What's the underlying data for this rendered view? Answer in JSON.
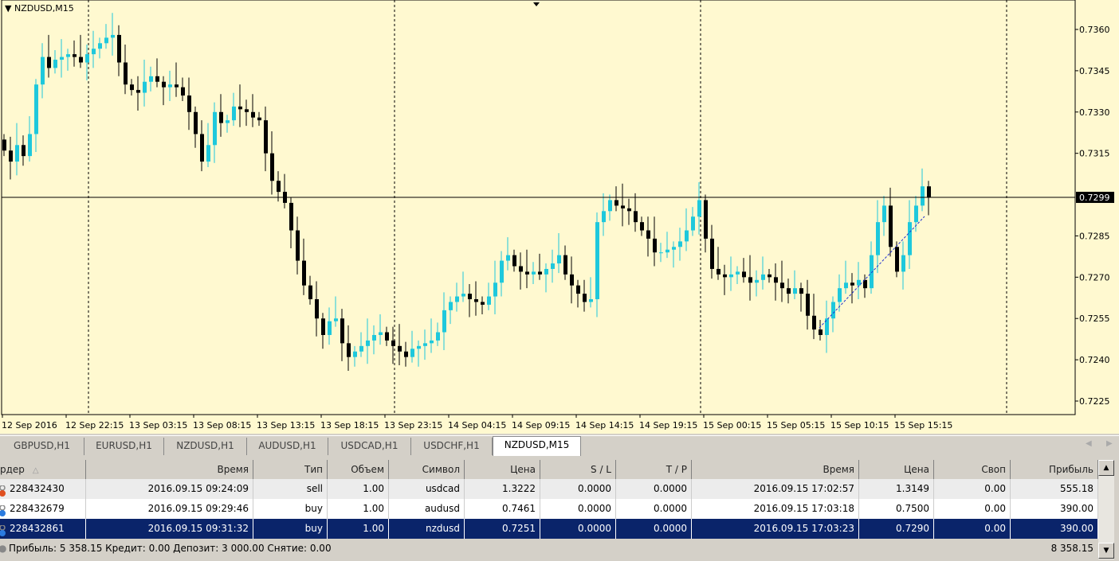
{
  "chart": {
    "symbol_label": "NZDUSD,M15",
    "background": "#fff9d0",
    "bull_color": "#1ec8dc",
    "bear_color": "#000000",
    "current_price": "0.7299",
    "price_ticks": [
      "0.7360",
      "0.7345",
      "0.7330",
      "0.7315",
      "0.7285",
      "0.7270",
      "0.7255",
      "0.7240",
      "0.7225"
    ],
    "time_ticks": [
      "12 Sep 2016",
      "12 Sep 22:15",
      "13 Sep 03:15",
      "13 Sep 08:15",
      "13 Sep 13:15",
      "13 Sep 18:15",
      "13 Sep 23:15",
      "14 Sep 04:15",
      "14 Sep 09:15",
      "14 Sep 14:15",
      "14 Sep 19:15",
      "15 Sep 00:15",
      "15 Sep 05:15",
      "15 Sep 10:15",
      "15 Sep 15:15"
    ]
  },
  "chart_data": {
    "type": "candlestick",
    "ylim": [
      0.7215,
      0.7372
    ],
    "current_price": 0.7299,
    "closes": [
      0.7316,
      0.7312,
      0.7318,
      0.7314,
      0.7322,
      0.734,
      0.735,
      0.7346,
      0.7349,
      0.735,
      0.7351,
      0.735,
      0.7348,
      0.7351,
      0.7353,
      0.7355,
      0.7357,
      0.7358,
      0.7348,
      0.734,
      0.7338,
      0.7337,
      0.7341,
      0.7343,
      0.7341,
      0.7339,
      0.734,
      0.7339,
      0.7336,
      0.733,
      0.7322,
      0.7312,
      0.7318,
      0.733,
      0.7326,
      0.7327,
      0.7332,
      0.7331,
      0.733,
      0.7328,
      0.7327,
      0.7315,
      0.7305,
      0.7301,
      0.7297,
      0.7287,
      0.7276,
      0.7267,
      0.7262,
      0.7255,
      0.7249,
      0.7254,
      0.7255,
      0.7246,
      0.7241,
      0.7243,
      0.7245,
      0.7247,
      0.7249,
      0.725,
      0.7247,
      0.7245,
      0.7243,
      0.7241,
      0.7244,
      0.7245,
      0.7246,
      0.7247,
      0.725,
      0.7258,
      0.7261,
      0.7263,
      0.7264,
      0.7262,
      0.7261,
      0.726,
      0.7263,
      0.7268,
      0.7276,
      0.7278,
      0.7274,
      0.7272,
      0.7271,
      0.7272,
      0.7271,
      0.7273,
      0.7275,
      0.7278,
      0.7271,
      0.7267,
      0.7264,
      0.7261,
      0.7262,
      0.729,
      0.7294,
      0.7298,
      0.7296,
      0.7295,
      0.7294,
      0.729,
      0.7287,
      0.7284,
      0.7279,
      0.7279,
      0.728,
      0.7281,
      0.7283,
      0.7287,
      0.7292,
      0.7298,
      0.7284,
      0.7273,
      0.7271,
      0.727,
      0.7271,
      0.7272,
      0.727,
      0.7268,
      0.7269,
      0.7271,
      0.727,
      0.7268,
      0.7266,
      0.7264,
      0.7266,
      0.7264,
      0.7256,
      0.7251,
      0.7249,
      0.7255,
      0.7261,
      0.7266,
      0.7268,
      0.7267,
      0.7269,
      0.7266,
      0.7278,
      0.729,
      0.7296,
      0.7281,
      0.7272,
      0.7278,
      0.729,
      0.7296,
      0.7303,
      0.7299
    ]
  },
  "tabs": [
    {
      "label": "GBPUSD,H1"
    },
    {
      "label": "EURUSD,H1"
    },
    {
      "label": "NZDUSD,H1"
    },
    {
      "label": "AUDUSD,H1"
    },
    {
      "label": "USDCAD,H1"
    },
    {
      "label": "USDCHF,H1"
    },
    {
      "label": "NZDUSD,M15",
      "active": true
    }
  ],
  "table": {
    "headers": [
      "рдер",
      "Время",
      "Тип",
      "Объем",
      "Символ",
      "Цена",
      "S / L",
      "T / P",
      "Время",
      "Цена",
      "Своп",
      "Прибыль"
    ],
    "sort_indicator": "△",
    "rows": [
      {
        "icon": "sell-order-icon",
        "cells": [
          "228432430",
          "2016.09.15 09:24:09",
          "sell",
          "1.00",
          "usdcad",
          "1.3222",
          "0.0000",
          "0.0000",
          "2016.09.15 17:02:57",
          "1.3149",
          "0.00",
          "555.18"
        ]
      },
      {
        "icon": "buy-order-icon",
        "cells": [
          "228432679",
          "2016.09.15 09:29:46",
          "buy",
          "1.00",
          "audusd",
          "0.7461",
          "0.0000",
          "0.0000",
          "2016.09.15 17:03:18",
          "0.7500",
          "0.00",
          "390.00"
        ]
      },
      {
        "icon": "buy-order-icon",
        "cells": [
          "228432861",
          "2016.09.15 09:31:32",
          "buy",
          "1.00",
          "nzdusd",
          "0.7251",
          "0.0000",
          "0.0000",
          "2016.09.15 17:03:23",
          "0.7290",
          "0.00",
          "390.00"
        ],
        "selected": true
      }
    ],
    "summary": "Прибыль: 5 358.15  Кредит: 0.00  Депозит: 3 000.00  Снятие: 0.00",
    "total": "8 358.15"
  }
}
